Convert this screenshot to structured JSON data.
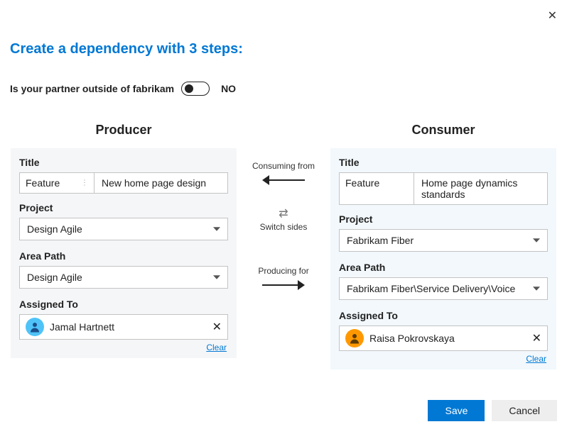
{
  "heading": "Create a dependency with 3 steps:",
  "partner_question": "Is your partner outside of",
  "partner_org": "fabrikam",
  "partner_state": "NO",
  "labels": {
    "title": "Title",
    "project": "Project",
    "area_path": "Area Path",
    "assigned_to": "Assigned To",
    "clear": "Clear"
  },
  "producer": {
    "heading": "Producer",
    "type": "Feature",
    "title_text": "New home page design",
    "project": "Design Agile",
    "area_path": "Design Agile",
    "assigned_to": "Jamal Hartnett"
  },
  "consumer": {
    "heading": "Consumer",
    "type": "Feature",
    "title_text": "Home page dynamics standards",
    "project": "Fabrikam Fiber",
    "area_path": "Fabrikam Fiber\\Service Delivery\\Voice",
    "assigned_to": "Raisa Pokrovskaya"
  },
  "middle": {
    "consuming_from": "Consuming from",
    "switch_sides": "Switch sides",
    "producing_for": "Producing for"
  },
  "footer": {
    "save": "Save",
    "cancel": "Cancel"
  }
}
